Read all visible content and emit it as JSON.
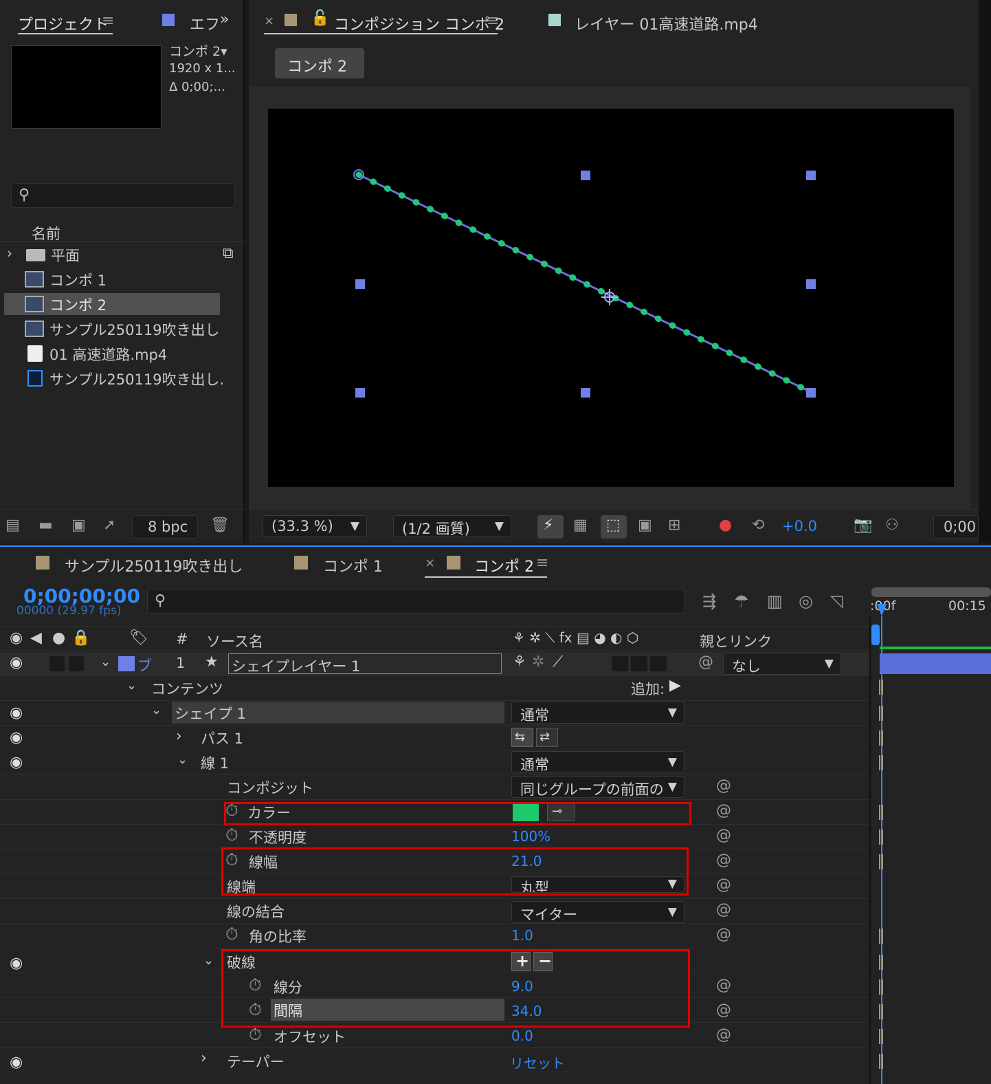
{
  "project": {
    "tab": "プロジェクト",
    "tab2": "エフ",
    "item_name": "コンポ 2▾",
    "item_size": "1920 x 1...",
    "item_dur": "Δ 0;00;...",
    "col_name": "名前",
    "items": [
      {
        "label": "平面"
      },
      {
        "label": "コンポ 1"
      },
      {
        "label": "コンポ 2"
      },
      {
        "label": "サンプル250119吹き出し"
      },
      {
        "label": "01 高速道路.mp4"
      },
      {
        "label": "サンプル250119吹き出し."
      }
    ],
    "bpc": "8 bpc"
  },
  "comp_viewer": {
    "tab_comp": "コンポジション コンポ 2",
    "tab_layer": "レイヤー 01高速道路.mp4",
    "crumb": "コンポ 2",
    "zoom": "(33.3 %)",
    "quality": "(1/2 画質)",
    "exposure": "+0.0",
    "time": "0;00"
  },
  "timeline": {
    "tabs": [
      {
        "label": "サンプル250119吹き出し"
      },
      {
        "label": "コンポ 1"
      },
      {
        "label": "コンポ 2"
      }
    ],
    "timecode": "0;00;00;00",
    "frames": "00000 (29.97 fps)",
    "col_num": "#",
    "col_source": "ソース名",
    "col_parent": "親とリンク",
    "ruler": [
      ":00f",
      "00:15"
    ],
    "layer": {
      "num": "1",
      "label_short": "ブ",
      "name": "シェイプレイヤー 1",
      "parent": "なし"
    },
    "rows": {
      "contents": "コンテンツ",
      "add": "追加:",
      "shape1": "シェイプ 1",
      "shape1_mode": "通常",
      "path1": "パス 1",
      "stroke1": "線 1",
      "stroke1_mode": "通常",
      "composite": "コンポジット",
      "composite_val": "同じグループの前面の",
      "color": "カラー",
      "color_hex": "#1ec86e",
      "opacity": "不透明度",
      "opacity_val": "100%",
      "width": "線幅",
      "width_val": "21.0",
      "cap": "線端",
      "cap_val": "丸型",
      "join": "線の結合",
      "join_val": "マイター",
      "miter": "角の比率",
      "miter_val": "1.0",
      "dashes": "破線",
      "dash": "線分",
      "dash_val": "9.0",
      "gap": "間隔",
      "gap_val": "34.0",
      "offset": "オフセット",
      "offset_val": "0.0",
      "taper": "テーパー",
      "taper_val": "リセット"
    }
  }
}
